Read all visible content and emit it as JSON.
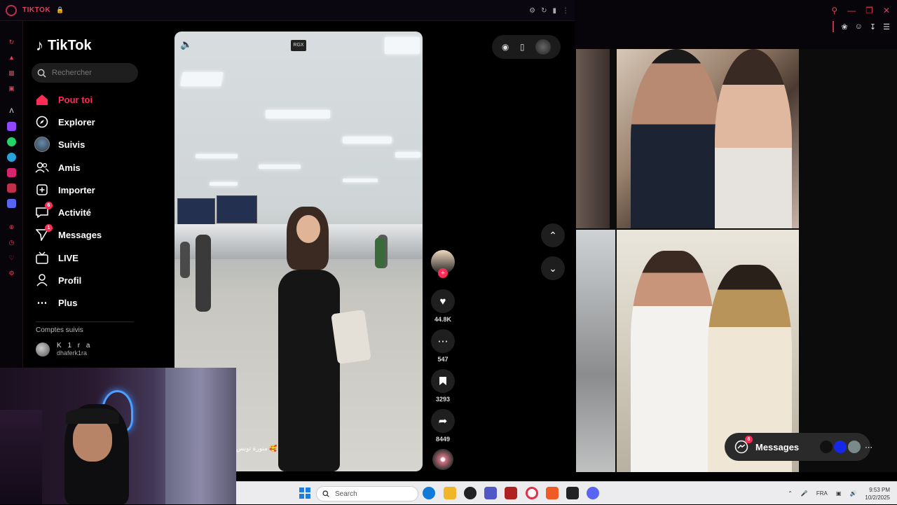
{
  "browser": {
    "tab_title": "TIKTOK",
    "lock_icon": "lock-icon",
    "accent": "#e0405a"
  },
  "tiktok": {
    "logo_text": "TikTok",
    "search_placeholder": "Rechercher",
    "nav": [
      {
        "label": "Pour toi",
        "icon": "home-icon",
        "active": true
      },
      {
        "label": "Explorer",
        "icon": "compass-icon"
      },
      {
        "label": "Suivis",
        "icon": "avatar-icon"
      },
      {
        "label": "Amis",
        "icon": "friends-icon"
      },
      {
        "label": "Importer",
        "icon": "upload-icon"
      },
      {
        "label": "Activité",
        "icon": "inbox-icon",
        "badge": "6"
      },
      {
        "label": "Messages",
        "icon": "send-icon",
        "badge": "1"
      },
      {
        "label": "LIVE",
        "icon": "live-icon"
      },
      {
        "label": "Profil",
        "icon": "user-icon"
      },
      {
        "label": "Plus",
        "icon": "more-icon"
      }
    ],
    "following_title": "Comptes suivis",
    "following": [
      {
        "name": "K 1 r a",
        "handle": "dhaferk1ra"
      }
    ],
    "accent": "#fe2c55"
  },
  "video": {
    "watermark": "RGX",
    "caption": "منورة تونس 🥰"
  },
  "actions": {
    "likes": "44.8K",
    "comments": "547",
    "saves": "3293",
    "shares": "8449"
  },
  "messages_widget": {
    "label": "Messages",
    "badge": "6"
  },
  "taskbar": {
    "search_label": "Search",
    "language": "FRA",
    "time": "9:53 PM",
    "date": "10/2/2025"
  }
}
